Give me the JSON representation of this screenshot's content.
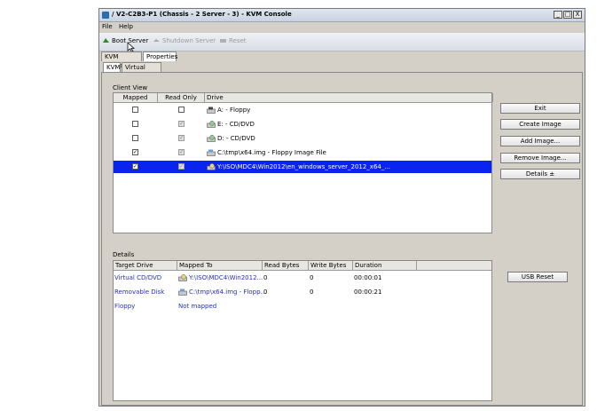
{
  "window": {
    "title": "/ V2-C2B3-P1 (Chassis - 2 Server - 3) - KVM Console",
    "controls": [
      "_",
      "□",
      "X"
    ]
  },
  "menu": [
    "File",
    "Help"
  ],
  "toolbar": {
    "boot": "Boot Server",
    "shutdown": "Shutdown Server",
    "reset": "Reset"
  },
  "tabs": {
    "kvm_console": "KVM Console",
    "properties": "Properties",
    "kvm": "KVM",
    "virtual_media": "Virtual Media"
  },
  "client_view": {
    "label": "Client View",
    "headers": [
      "Mapped",
      "Read Only",
      "Drive"
    ],
    "rows": [
      {
        "mapped": false,
        "read_only": false,
        "read_only_enabled": true,
        "drive": "A: - Floppy",
        "icon": "floppy-drive-icon",
        "selected": false
      },
      {
        "mapped": false,
        "read_only": true,
        "read_only_enabled": false,
        "drive": "E: - CD/DVD",
        "icon": "cd-drive-icon",
        "selected": false
      },
      {
        "mapped": false,
        "read_only": true,
        "read_only_enabled": false,
        "drive": "D: - CD/DVD",
        "icon": "cd-drive-icon",
        "selected": false
      },
      {
        "mapped": true,
        "read_only": true,
        "read_only_enabled": false,
        "drive": "C:\\tmp\\x64.img - Floppy Image File",
        "icon": "floppy-image-icon",
        "selected": false
      },
      {
        "mapped": true,
        "read_only": true,
        "read_only_enabled": false,
        "drive": "Y:\\ISO\\MDC4\\Win2012\\en_windows_server_2012_x64_...",
        "icon": "disc-image-icon",
        "selected": true
      }
    ]
  },
  "side_buttons": {
    "exit": "Exit",
    "create_image": "Create Image",
    "add_image": "Add Image...",
    "remove_image": "Remove Image...",
    "details": "Details ±",
    "usb_reset": "USB Reset"
  },
  "details": {
    "label": "Details",
    "headers": [
      "Target Drive",
      "Mapped To",
      "Read Bytes",
      "Write Bytes",
      "Duration"
    ],
    "rows": [
      {
        "target": "Virtual CD/DVD",
        "mapped_to": "Y:\\ISO\\MDC4\\Win2012...",
        "read_bytes": "0",
        "write_bytes": "0",
        "duration": "00:00:01"
      },
      {
        "target": "Removable Disk",
        "mapped_to": "C:\\tmp\\x64.img - Flopp...",
        "read_bytes": "0",
        "write_bytes": "0",
        "duration": "00:00:21"
      },
      {
        "target": "Floppy",
        "mapped_to": "Not mapped",
        "read_bytes": "",
        "write_bytes": "",
        "duration": ""
      }
    ]
  },
  "colors": {
    "selection": "#0a24f0",
    "link": "#2233bb",
    "window_bg": "#d4d0c8"
  }
}
